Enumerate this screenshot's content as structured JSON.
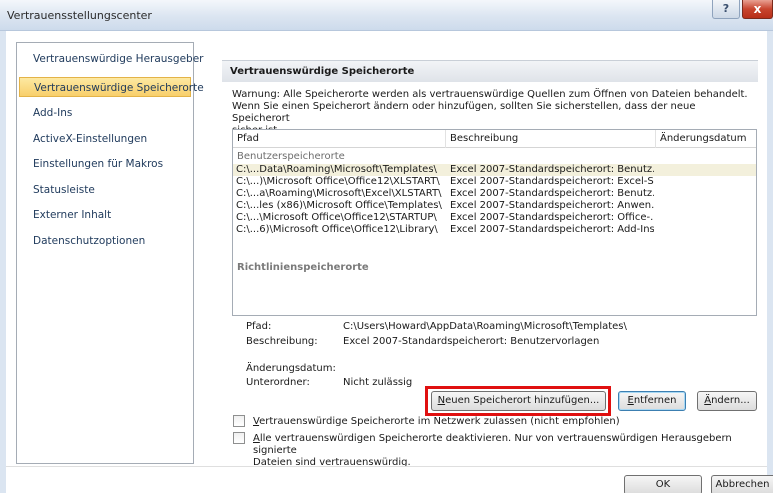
{
  "window": {
    "title": "Vertrauensstellungscenter",
    "help_label": "?",
    "close_label": "x"
  },
  "sidebar": {
    "items": [
      {
        "label": "Vertrauenswürdige Herausgeber"
      },
      {
        "label": "Vertrauenswürdige Speicherorte",
        "selected": true
      },
      {
        "label": "Add-Ins"
      },
      {
        "label": "ActiveX-Einstellungen"
      },
      {
        "label": "Einstellungen für Makros"
      },
      {
        "label": "Statusleiste"
      },
      {
        "label": "Externer Inhalt"
      },
      {
        "label": "Datenschutzoptionen"
      }
    ]
  },
  "main": {
    "section_title": "Vertrauenswürdige Speicherorte",
    "warning_lines": [
      "Warnung: Alle Speicherorte werden als vertrauenswürdige Quellen zum Öffnen von Dateien behandelt.",
      "Wenn Sie einen Speicherort ändern oder hinzufügen, sollten Sie sicherstellen, dass der neue Speicherort",
      "sicher ist."
    ],
    "list": {
      "columns": [
        "Pfad",
        "Beschreibung",
        "Änderungsdatum"
      ],
      "group_user": "Benutzerspeicherorte",
      "group_policy": "Richtlinienspeicherorte",
      "rows": [
        {
          "path": "C:\\...Data\\Roaming\\Microsoft\\Templates\\",
          "desc": "Excel 2007-Standardspeicherort: Benutz...",
          "date": "",
          "selected": true
        },
        {
          "path": "C:\\...)\\Microsoft Office\\Office12\\XLSTART\\",
          "desc": "Excel 2007-Standardspeicherort: Excel-S...",
          "date": ""
        },
        {
          "path": "C:\\...a\\Roaming\\Microsoft\\Excel\\XLSTART\\",
          "desc": "Excel 2007-Standardspeicherort: Benutz...",
          "date": ""
        },
        {
          "path": "C:\\...les (x86)\\Microsoft Office\\Templates\\",
          "desc": "Excel 2007-Standardspeicherort: Anwen...",
          "date": ""
        },
        {
          "path": "C:\\...\\Microsoft Office\\Office12\\STARTUP\\",
          "desc": "Excel 2007-Standardspeicherort: Office-...",
          "date": ""
        },
        {
          "path": "C:\\...6)\\Microsoft Office\\Office12\\Library\\",
          "desc": "Excel 2007-Standardspeicherort: Add-Ins",
          "date": ""
        }
      ]
    },
    "details": {
      "path_label": "Pfad:",
      "path_value": "C:\\Users\\Howard\\AppData\\Roaming\\Microsoft\\Templates\\",
      "desc_label": "Beschreibung:",
      "desc_value": "Excel 2007-Standardspeicherort: Benutzervorlagen",
      "date_label": "Änderungsdatum:",
      "sub_label": "Unterordner:",
      "sub_value": "Nicht zulässig"
    },
    "buttons": {
      "add_accel": "N",
      "add_rest": "euen Speicherort hinzufügen...",
      "remove_accel": "E",
      "remove_rest": "ntfernen",
      "change_accel": "Ä",
      "change_rest": "ndern..."
    },
    "checkboxes": {
      "network_accel": "V",
      "network_rest": "ertrauenswürdige Speicherorte im Netzwerk zulassen (nicht empfohlen)",
      "disable_accel": "A",
      "disable_rest": "lle vertrauenswürdigen Speicherorte deaktivieren. Nur von vertrauenswürdigen Herausgebern signierte",
      "disable_line2": "Dateien sind vertrauenswürdig."
    }
  },
  "footer": {
    "ok_label": "OK",
    "cancel_label": "Abbrechen"
  },
  "colors": {
    "selected_item": "#f8cf6b",
    "highlight_box": "#e01010",
    "close_button": "#c8452e"
  }
}
